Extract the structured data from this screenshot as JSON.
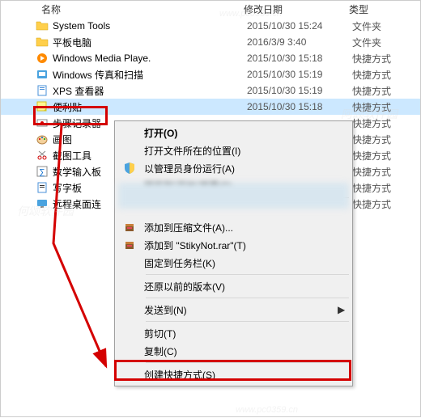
{
  "header": {
    "name": "名称",
    "date": "修改日期",
    "type": "类型"
  },
  "files": [
    {
      "name": "System Tools",
      "date": "2015/10/30 15:24",
      "type": "文件夹",
      "icon": "folder"
    },
    {
      "name": "平板电脑",
      "date": "2016/3/9 3:40",
      "type": "文件夹",
      "icon": "folder"
    },
    {
      "name": "Windows Media Playe.",
      "date": "2015/10/30 15:18",
      "type": "快捷方式",
      "icon": "wmp"
    },
    {
      "name": "Windows 传真和扫描",
      "date": "2015/10/30 15:19",
      "type": "快捷方式",
      "icon": "fax"
    },
    {
      "name": "XPS 查看器",
      "date": "2015/10/30 15:19",
      "type": "快捷方式",
      "icon": "xps"
    },
    {
      "name": "便利贴",
      "date": "2015/10/30 15:18",
      "type": "快捷方式",
      "icon": "note",
      "selected": true
    },
    {
      "name": "步骤记录器",
      "date": "",
      "type": "快捷方式",
      "icon": "rec"
    },
    {
      "name": "画图",
      "date": "",
      "type": "快捷方式",
      "icon": "paint"
    },
    {
      "name": "截图工具",
      "date": "",
      "type": "快捷方式",
      "icon": "snip"
    },
    {
      "name": "数学输入板",
      "date": "",
      "type": "快捷方式",
      "icon": "math"
    },
    {
      "name": "写字板",
      "date": "",
      "type": "快捷方式",
      "icon": "wordpad"
    },
    {
      "name": "远程桌面连",
      "date": "",
      "type": "快捷方式",
      "icon": "rdp"
    }
  ],
  "visible_types_below_menu": [
    "快捷方式",
    "快捷方式",
    "快捷方式",
    "快捷方式",
    "快捷方式",
    "快捷方式"
  ],
  "menu": {
    "groups": [
      [
        {
          "label": "打开(O)",
          "icon": "",
          "bold": true
        },
        {
          "label": "打开文件所在的位置(I)",
          "icon": ""
        },
        {
          "label": "以管理员身份运行(A)",
          "icon": "shield"
        },
        {
          "label": "固定到\"开始\"屏幕(P)",
          "icon": "",
          "blur": true
        }
      ],
      [
        {
          "label": "",
          "icon": "",
          "blur": true
        },
        {
          "label": "添加到压缩文件(A)...",
          "icon": "rar"
        },
        {
          "label": "添加到 \"StikyNot.rar\"(T)",
          "icon": "rar"
        },
        {
          "label": "固定到任务栏(K)",
          "icon": ""
        }
      ],
      [
        {
          "label": "还原以前的版本(V)",
          "icon": ""
        }
      ],
      [
        {
          "label": "发送到(N)",
          "icon": "",
          "arrow": true
        }
      ],
      [
        {
          "label": "剪切(T)",
          "icon": ""
        },
        {
          "label": "复制(C)",
          "icon": ""
        }
      ],
      [
        {
          "label": "创建快捷方式(S)",
          "icon": ""
        }
      ]
    ]
  },
  "watermarks": [
    "何颂软件园",
    "阿颂软件园",
    "www.pc0359.cn"
  ]
}
